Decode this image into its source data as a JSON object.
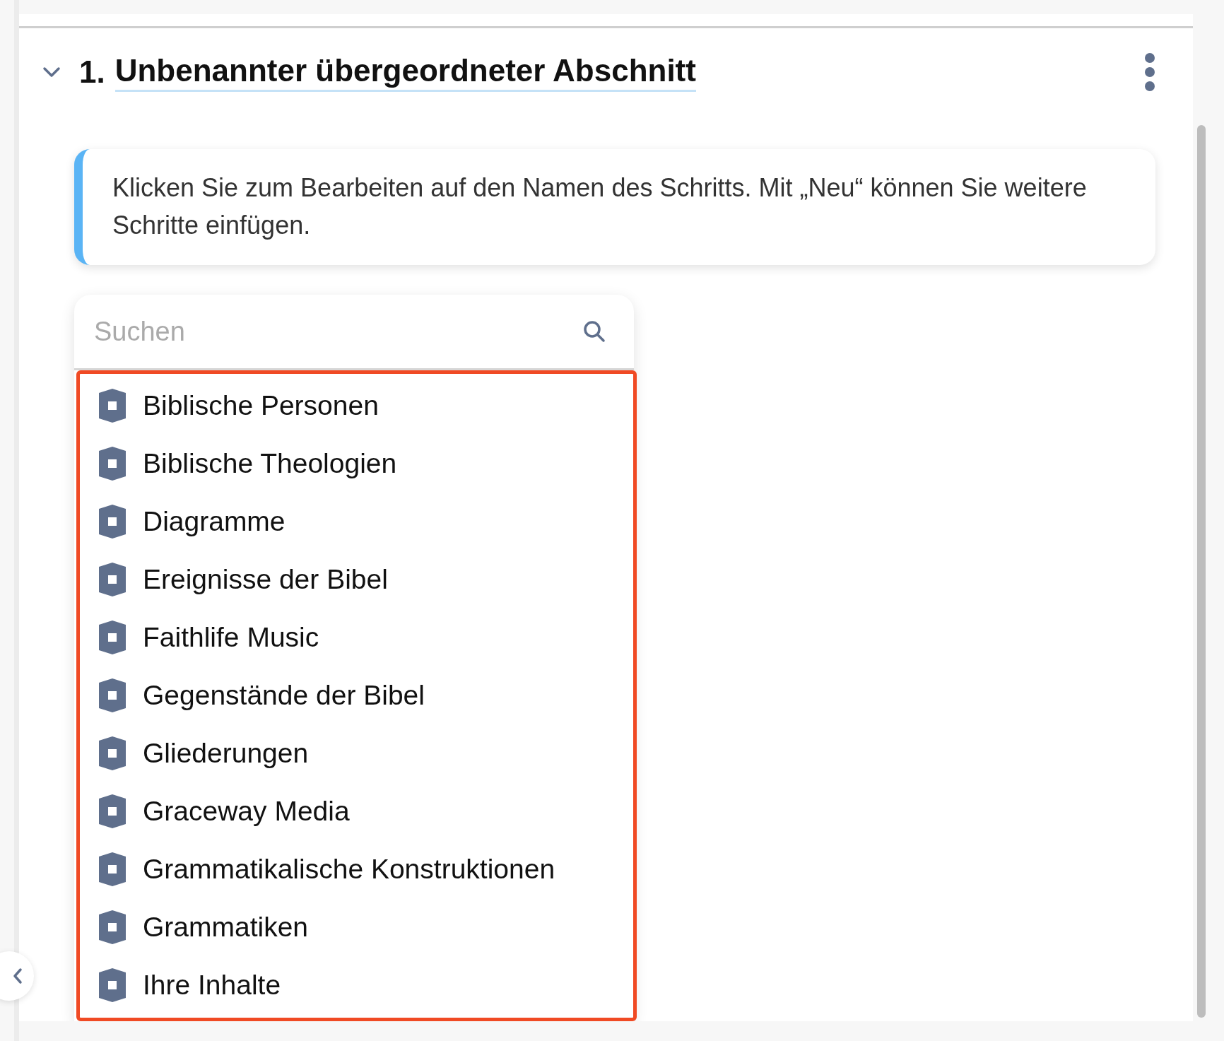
{
  "section": {
    "expanded": true,
    "number": "1.",
    "title": "Unbenannter übergeordneter Abschnitt"
  },
  "hint": "Klicken Sie zum Bearbeiten auf den Namen des Schritts. Mit „Neu“ können Sie weitere Schritte einfügen.",
  "search": {
    "placeholder": "Suchen"
  },
  "items": [
    "Biblische Personen",
    "Biblische Theologien",
    "Diagramme",
    "Ereignisse der Bibel",
    "Faithlife Music",
    "Gegenstände der Bibel",
    "Gliederungen",
    "Graceway Media",
    "Grammatikalische Konstruktionen",
    "Grammatiken",
    "Ihre Inhalte"
  ]
}
